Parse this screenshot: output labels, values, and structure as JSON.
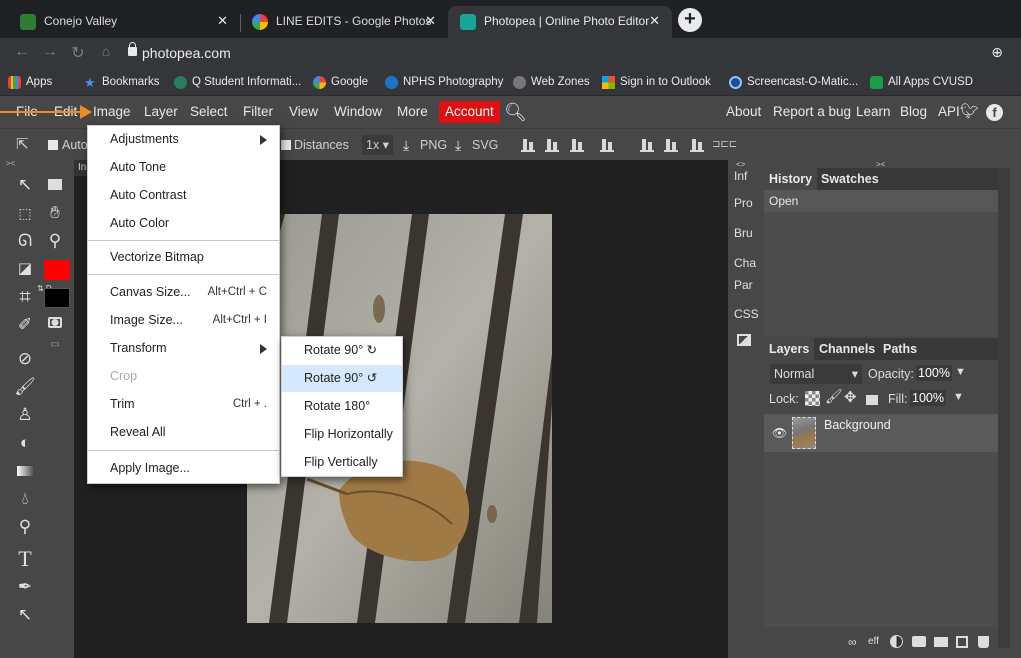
{
  "browser": {
    "tabs": [
      {
        "title": "Conejo Valley",
        "color": "#2e7d32"
      },
      {
        "title": "LINE EDITS - Google Photos",
        "color": "#fbbc04"
      },
      {
        "title": "Photopea | Online Photo Editor",
        "color": "#18a497"
      }
    ],
    "new_tab": "+",
    "close": "✕",
    "url": "photopea.com",
    "bookmarks": [
      "Apps",
      "Bookmarks",
      "Q Student Informati...",
      "Google",
      "NPHS Photography",
      "Web Zones",
      "Sign in to Outlook",
      "Screencast-O-Matic...",
      "All Apps CVUSD"
    ]
  },
  "menubar": {
    "items": [
      "File",
      "Edit",
      "Image",
      "Layer",
      "Select",
      "Filter",
      "View",
      "Window",
      "More"
    ],
    "account": "Account",
    "right": [
      "About",
      "Report a bug",
      "Learn",
      "Blog",
      "API"
    ]
  },
  "tool_options": {
    "auto": "Auto",
    "distances": "Distances",
    "scale": "1x ▾",
    "png": "PNG",
    "svg": "SVG"
  },
  "doc_tab": "In",
  "colors": {
    "foreground": "#ff0000",
    "background": "#000000",
    "accent": "#d11111",
    "highlight": "#d6e8fb"
  },
  "image_menu": [
    {
      "label": "Adjustments",
      "submenu": true
    },
    {
      "label": "Auto Tone"
    },
    {
      "label": "Auto Contrast"
    },
    {
      "label": "Auto Color"
    },
    {
      "label": "Vectorize Bitmap"
    },
    {
      "label": "Canvas Size...",
      "shortcut": "Alt+Ctrl + C"
    },
    {
      "label": "Image Size...",
      "shortcut": "Alt+Ctrl + I"
    },
    {
      "label": "Transform",
      "submenu": true
    },
    {
      "label": "Crop",
      "disabled": true
    },
    {
      "label": "Trim",
      "shortcut": "Ctrl + ."
    },
    {
      "label": "Reveal All"
    },
    {
      "label": "Apply Image..."
    }
  ],
  "transform_menu": [
    "Rotate 90° ↻",
    "Rotate 90° ↺",
    "Rotate 180°",
    "Flip Horizontally",
    "Flip Vertically"
  ],
  "side_tabs": [
    "Inf",
    "Pro",
    "Bru",
    "Cha",
    "Par",
    "CSS"
  ],
  "history_panel": {
    "tabs": [
      "History",
      "Swatches"
    ],
    "items": [
      "Open"
    ]
  },
  "layers_panel": {
    "tabs": [
      "Layers",
      "Channels",
      "Paths"
    ],
    "blend": "Normal",
    "opacity_label": "Opacity:",
    "opacity": "100%",
    "lock_label": "Lock:",
    "fill_label": "Fill:",
    "fill": "100%",
    "layers": [
      "Background"
    ]
  }
}
